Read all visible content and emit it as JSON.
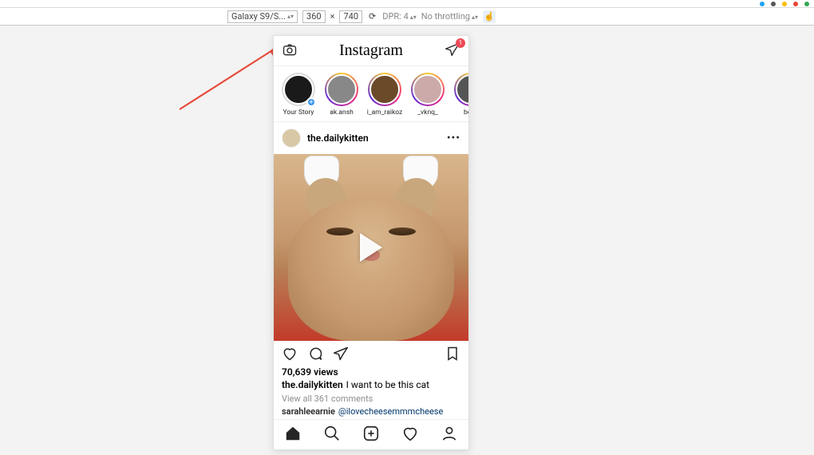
{
  "devtools": {
    "device": "Galaxy S9/S...",
    "width": "360",
    "height": "740",
    "dpr_label": "DPR: 4",
    "throttling": "No throttling"
  },
  "header": {
    "logo_text": "Instagram",
    "dm_badge": "1"
  },
  "stories": [
    {
      "label": "Your Story",
      "has_story": false,
      "is_own": true,
      "bg": "#1a1a1a"
    },
    {
      "label": "ak.ansh",
      "has_story": true,
      "bg": "#888"
    },
    {
      "label": "i_am_raikoz",
      "has_story": true,
      "bg": "#6b4a2a"
    },
    {
      "label": "_vknq_",
      "has_story": true,
      "bg": "#caa"
    },
    {
      "label": "be_tl",
      "has_story": true,
      "bg": "#555"
    }
  ],
  "post": {
    "username": "the.dailykitten",
    "views": "70,639 views",
    "caption_user": "the.dailykitten",
    "caption_text": "I want to be this cat",
    "view_all": "View all 361 comments",
    "comment_user": "sarahleearnie",
    "comment_mention": "@ilovecheesemmmcheese"
  }
}
